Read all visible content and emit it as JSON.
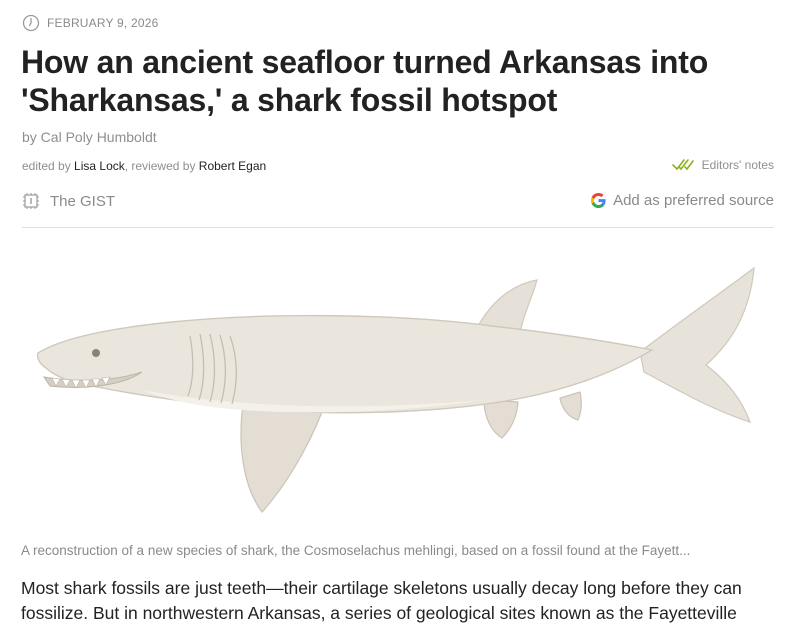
{
  "article": {
    "date": "FEBRUARY 9, 2026",
    "title": "How an ancient seafloor turned Arkansas into 'Sharkansas,' a shark fossil hotspot",
    "byline": "by Cal Poly Humboldt",
    "edited_prefix": "edited by",
    "editor": "Lisa Lock",
    "reviewed_prefix": ", reviewed by",
    "reviewer": "Robert Egan",
    "editors_notes": "Editors' notes",
    "gist_label": "The GIST",
    "preferred_source": "Add as preferred source",
    "caption": "A reconstruction of a new species of shark, the Cosmoselachus mehlingi, based on a fossil found at the Fayett...",
    "body": "Most shark fossils are just teeth—their cartilage skeletons usually decay long before they can fossilize. But in northwestern Arkansas, a series of geological sites known as the Fayetteville"
  },
  "icons": {
    "date": "clock-icon",
    "editors_notes": "double-check-icon",
    "gist": "gist-chip-icon",
    "preferred": "google-g-icon"
  },
  "colors": {
    "meta_text": "#8a8a8a",
    "title_text": "#222222",
    "check_green": "#8cb31c",
    "divider": "#dedede"
  }
}
